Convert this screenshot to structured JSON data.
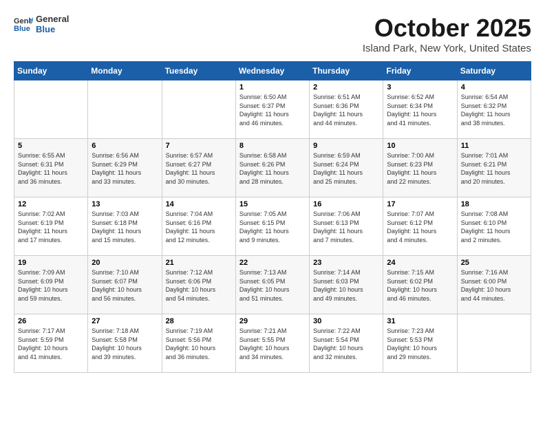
{
  "logo": {
    "general": "General",
    "blue": "Blue"
  },
  "header": {
    "title": "October 2025",
    "subtitle": "Island Park, New York, United States"
  },
  "weekdays": [
    "Sunday",
    "Monday",
    "Tuesday",
    "Wednesday",
    "Thursday",
    "Friday",
    "Saturday"
  ],
  "weeks": [
    [
      {
        "day": "",
        "info": ""
      },
      {
        "day": "",
        "info": ""
      },
      {
        "day": "",
        "info": ""
      },
      {
        "day": "1",
        "info": "Sunrise: 6:50 AM\nSunset: 6:37 PM\nDaylight: 11 hours\nand 46 minutes."
      },
      {
        "day": "2",
        "info": "Sunrise: 6:51 AM\nSunset: 6:36 PM\nDaylight: 11 hours\nand 44 minutes."
      },
      {
        "day": "3",
        "info": "Sunrise: 6:52 AM\nSunset: 6:34 PM\nDaylight: 11 hours\nand 41 minutes."
      },
      {
        "day": "4",
        "info": "Sunrise: 6:54 AM\nSunset: 6:32 PM\nDaylight: 11 hours\nand 38 minutes."
      }
    ],
    [
      {
        "day": "5",
        "info": "Sunrise: 6:55 AM\nSunset: 6:31 PM\nDaylight: 11 hours\nand 36 minutes."
      },
      {
        "day": "6",
        "info": "Sunrise: 6:56 AM\nSunset: 6:29 PM\nDaylight: 11 hours\nand 33 minutes."
      },
      {
        "day": "7",
        "info": "Sunrise: 6:57 AM\nSunset: 6:27 PM\nDaylight: 11 hours\nand 30 minutes."
      },
      {
        "day": "8",
        "info": "Sunrise: 6:58 AM\nSunset: 6:26 PM\nDaylight: 11 hours\nand 28 minutes."
      },
      {
        "day": "9",
        "info": "Sunrise: 6:59 AM\nSunset: 6:24 PM\nDaylight: 11 hours\nand 25 minutes."
      },
      {
        "day": "10",
        "info": "Sunrise: 7:00 AM\nSunset: 6:23 PM\nDaylight: 11 hours\nand 22 minutes."
      },
      {
        "day": "11",
        "info": "Sunrise: 7:01 AM\nSunset: 6:21 PM\nDaylight: 11 hours\nand 20 minutes."
      }
    ],
    [
      {
        "day": "12",
        "info": "Sunrise: 7:02 AM\nSunset: 6:19 PM\nDaylight: 11 hours\nand 17 minutes."
      },
      {
        "day": "13",
        "info": "Sunrise: 7:03 AM\nSunset: 6:18 PM\nDaylight: 11 hours\nand 15 minutes."
      },
      {
        "day": "14",
        "info": "Sunrise: 7:04 AM\nSunset: 6:16 PM\nDaylight: 11 hours\nand 12 minutes."
      },
      {
        "day": "15",
        "info": "Sunrise: 7:05 AM\nSunset: 6:15 PM\nDaylight: 11 hours\nand 9 minutes."
      },
      {
        "day": "16",
        "info": "Sunrise: 7:06 AM\nSunset: 6:13 PM\nDaylight: 11 hours\nand 7 minutes."
      },
      {
        "day": "17",
        "info": "Sunrise: 7:07 AM\nSunset: 6:12 PM\nDaylight: 11 hours\nand 4 minutes."
      },
      {
        "day": "18",
        "info": "Sunrise: 7:08 AM\nSunset: 6:10 PM\nDaylight: 11 hours\nand 2 minutes."
      }
    ],
    [
      {
        "day": "19",
        "info": "Sunrise: 7:09 AM\nSunset: 6:09 PM\nDaylight: 10 hours\nand 59 minutes."
      },
      {
        "day": "20",
        "info": "Sunrise: 7:10 AM\nSunset: 6:07 PM\nDaylight: 10 hours\nand 56 minutes."
      },
      {
        "day": "21",
        "info": "Sunrise: 7:12 AM\nSunset: 6:06 PM\nDaylight: 10 hours\nand 54 minutes."
      },
      {
        "day": "22",
        "info": "Sunrise: 7:13 AM\nSunset: 6:05 PM\nDaylight: 10 hours\nand 51 minutes."
      },
      {
        "day": "23",
        "info": "Sunrise: 7:14 AM\nSunset: 6:03 PM\nDaylight: 10 hours\nand 49 minutes."
      },
      {
        "day": "24",
        "info": "Sunrise: 7:15 AM\nSunset: 6:02 PM\nDaylight: 10 hours\nand 46 minutes."
      },
      {
        "day": "25",
        "info": "Sunrise: 7:16 AM\nSunset: 6:00 PM\nDaylight: 10 hours\nand 44 minutes."
      }
    ],
    [
      {
        "day": "26",
        "info": "Sunrise: 7:17 AM\nSunset: 5:59 PM\nDaylight: 10 hours\nand 41 minutes."
      },
      {
        "day": "27",
        "info": "Sunrise: 7:18 AM\nSunset: 5:58 PM\nDaylight: 10 hours\nand 39 minutes."
      },
      {
        "day": "28",
        "info": "Sunrise: 7:19 AM\nSunset: 5:56 PM\nDaylight: 10 hours\nand 36 minutes."
      },
      {
        "day": "29",
        "info": "Sunrise: 7:21 AM\nSunset: 5:55 PM\nDaylight: 10 hours\nand 34 minutes."
      },
      {
        "day": "30",
        "info": "Sunrise: 7:22 AM\nSunset: 5:54 PM\nDaylight: 10 hours\nand 32 minutes."
      },
      {
        "day": "31",
        "info": "Sunrise: 7:23 AM\nSunset: 5:53 PM\nDaylight: 10 hours\nand 29 minutes."
      },
      {
        "day": "",
        "info": ""
      }
    ]
  ]
}
